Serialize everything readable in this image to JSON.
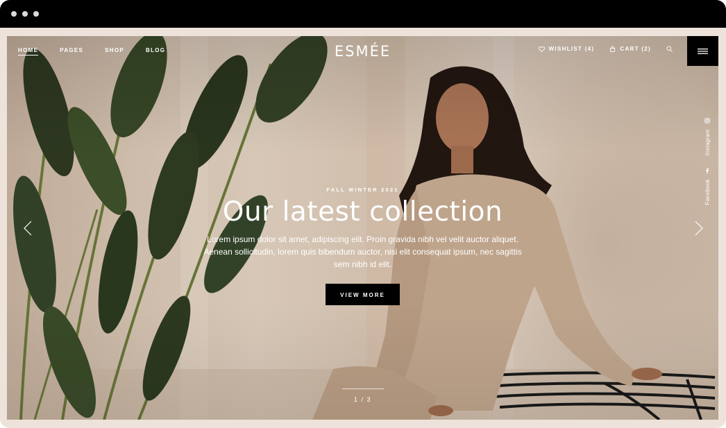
{
  "window": {
    "controls": [
      "dot",
      "dot",
      "dot"
    ]
  },
  "brand": {
    "logo": "ESMÉE"
  },
  "nav": {
    "left": [
      {
        "label": "HOME",
        "active": true
      },
      {
        "label": "PAGES",
        "active": false
      },
      {
        "label": "SHOP",
        "active": false
      },
      {
        "label": "BLOG",
        "active": false
      }
    ],
    "wishlist_label": "WISHLIST (4)",
    "cart_label": "CART (2)",
    "search_icon": "search-icon",
    "menu_icon": "hamburger-menu-icon"
  },
  "social": {
    "instagram_label": "Instagram",
    "facebook_label": "Facebook"
  },
  "hero": {
    "eyebrow": "FALL WINTER 2021",
    "headline": "Our latest collection",
    "description": "Lorem ipsum dolor sit amet, adipiscing elit. Proin gravida nibh vel velit auctor aliquet. Aenean sollicitudin, lorem quis bibendum auctor, nisi elit consequat ipsum, nec sagittis sem nibh id elit.",
    "cta_label": "VIEW MORE",
    "pagination": "1 / 3",
    "prev_icon": "chevron-left-icon",
    "next_icon": "chevron-right-icon"
  },
  "colors": {
    "frame": "#ede3da",
    "accent": "#000000",
    "text_on_image": "#ffffff"
  }
}
